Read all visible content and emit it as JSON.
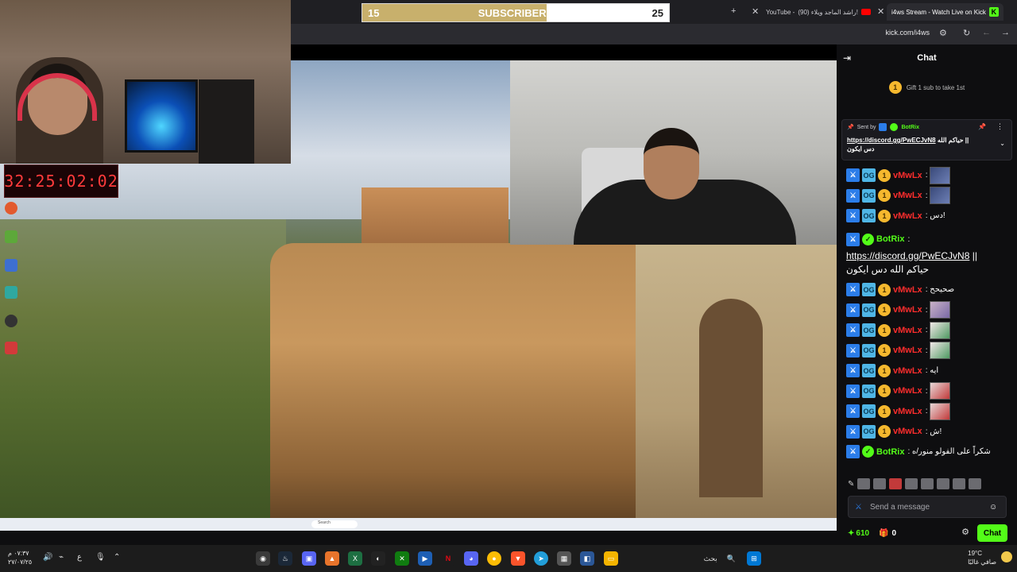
{
  "sub_goal": {
    "current": "15",
    "label": "SUBSCRIBERS",
    "goal": "25",
    "progress": 0.6
  },
  "timer": "32:25:02:02",
  "browser": {
    "tabs": [
      {
        "title": "(90) راشد الماجد ويلاء!",
        "prefix": "YouTube - "
      },
      {
        "title": "i4ws Stream - Watch Live on Kick"
      }
    ],
    "url": "kick.com/i4ws"
  },
  "chat": {
    "title": "Chat",
    "gift_text": "Gift 1 sub to take 1st",
    "gift_rank": "1",
    "pinned": {
      "sent_by_label": "Sent by",
      "sender": "BotRix",
      "link": "https://discord.gg/PwECJvN8",
      "text_ar": "حياكم الله ||",
      "text_ar2": "دس ايكون"
    },
    "messages": [
      {
        "user": "vMwLx",
        "text": ":",
        "emote": "e1"
      },
      {
        "user": "vMwLx",
        "text": ":",
        "emote": "e1"
      },
      {
        "user": "vMwLx",
        "text": ": دس!"
      },
      {
        "user": "BotRix",
        "bot": true,
        "text_link": "https://discord.gg/PwECJvN8",
        "text_sep": " ||",
        "text_ar": "حياكم الله دس ايكون"
      },
      {
        "user": "vMwLx",
        "text": ": صحيحح"
      },
      {
        "user": "vMwLx",
        "text": ":",
        "emote": "e2"
      },
      {
        "user": "vMwLx",
        "text": ":",
        "emote": "e3"
      },
      {
        "user": "vMwLx",
        "text": ":",
        "emote": "e3"
      },
      {
        "user": "vMwLx",
        "text": ": ايه"
      },
      {
        "user": "vMwLx",
        "text": ":",
        "emote": "e4"
      },
      {
        "user": "vMwLx",
        "text": ":",
        "emote": "e4"
      },
      {
        "user": "vMwLx",
        "text": ": ش!"
      },
      {
        "user": "BotRix",
        "bot": true,
        "text": ": شكراً على الفولو منور/ه"
      }
    ],
    "input_placeholder": "Send a message",
    "points": "610",
    "gifts": "0",
    "send_label": "Chat"
  },
  "taskbar": {
    "search_text": "بحث",
    "time": "٠٧:٣٧ م",
    "date": "٢٧/٠٧/٢٥",
    "lang": "ع",
    "weather_temp": "19°C",
    "weather_desc": "صافي غالبًا"
  },
  "colors": {
    "kick_green": "#53fc18",
    "username_red": "#ff2d2d",
    "timer_red": "#ff3b3b",
    "gold": "#c8b06c"
  }
}
